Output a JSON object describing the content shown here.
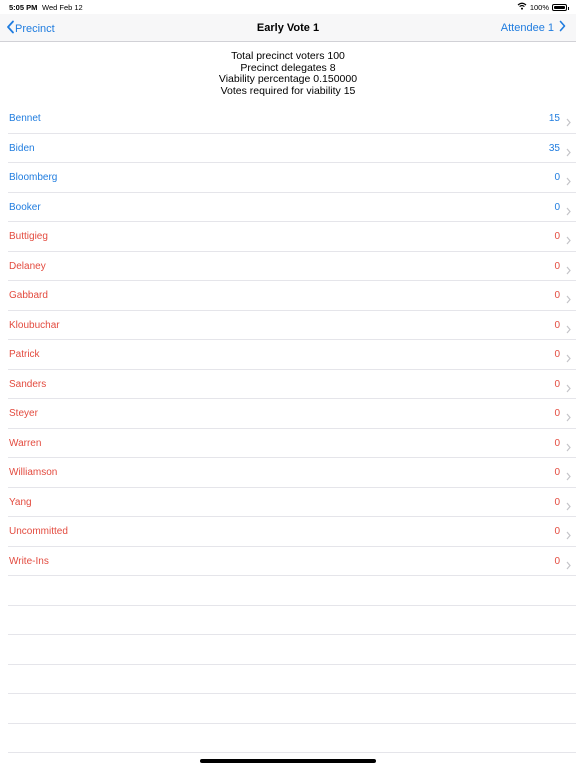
{
  "status": {
    "time": "5:05 PM",
    "date": "Wed Feb 12",
    "battery": "100%"
  },
  "nav": {
    "back_label": "Precinct",
    "title": "Early Vote 1",
    "right_label": "Attendee 1"
  },
  "summary": {
    "line1": "Total precinct voters 100",
    "line2": "Precinct delegates 8",
    "line3": "Viability percentage 0.150000",
    "line4": "Votes required for viability 15"
  },
  "candidates": [
    {
      "name": "Bennet",
      "count": "15",
      "color": "#1f7cdf"
    },
    {
      "name": "Biden",
      "count": "35",
      "color": "#1f7cdf"
    },
    {
      "name": "Bloomberg",
      "count": "0",
      "color": "#1f7cdf"
    },
    {
      "name": "Booker",
      "count": "0",
      "color": "#1f7cdf"
    },
    {
      "name": "Buttigieg",
      "count": "0",
      "color": "#e34b3f"
    },
    {
      "name": "Delaney",
      "count": "0",
      "color": "#e34b3f"
    },
    {
      "name": "Gabbard",
      "count": "0",
      "color": "#e34b3f"
    },
    {
      "name": "Kloubuchar",
      "count": "0",
      "color": "#e34b3f"
    },
    {
      "name": "Patrick",
      "count": "0",
      "color": "#e34b3f"
    },
    {
      "name": "Sanders",
      "count": "0",
      "color": "#e34b3f"
    },
    {
      "name": "Steyer",
      "count": "0",
      "color": "#e34b3f"
    },
    {
      "name": "Warren",
      "count": "0",
      "color": "#e34b3f"
    },
    {
      "name": "Williamson",
      "count": "0",
      "color": "#e34b3f"
    },
    {
      "name": "Yang",
      "count": "0",
      "color": "#e34b3f"
    },
    {
      "name": "Uncommitted",
      "count": "0",
      "color": "#e34b3f"
    },
    {
      "name": "Write-Ins",
      "count": "0",
      "color": "#e34b3f"
    }
  ],
  "icons": {
    "back": "chevron-left-icon",
    "forward": "chevron-right-icon",
    "row": "chevron-right-icon",
    "wifi": "wifi-icon",
    "battery": "battery-icon"
  }
}
